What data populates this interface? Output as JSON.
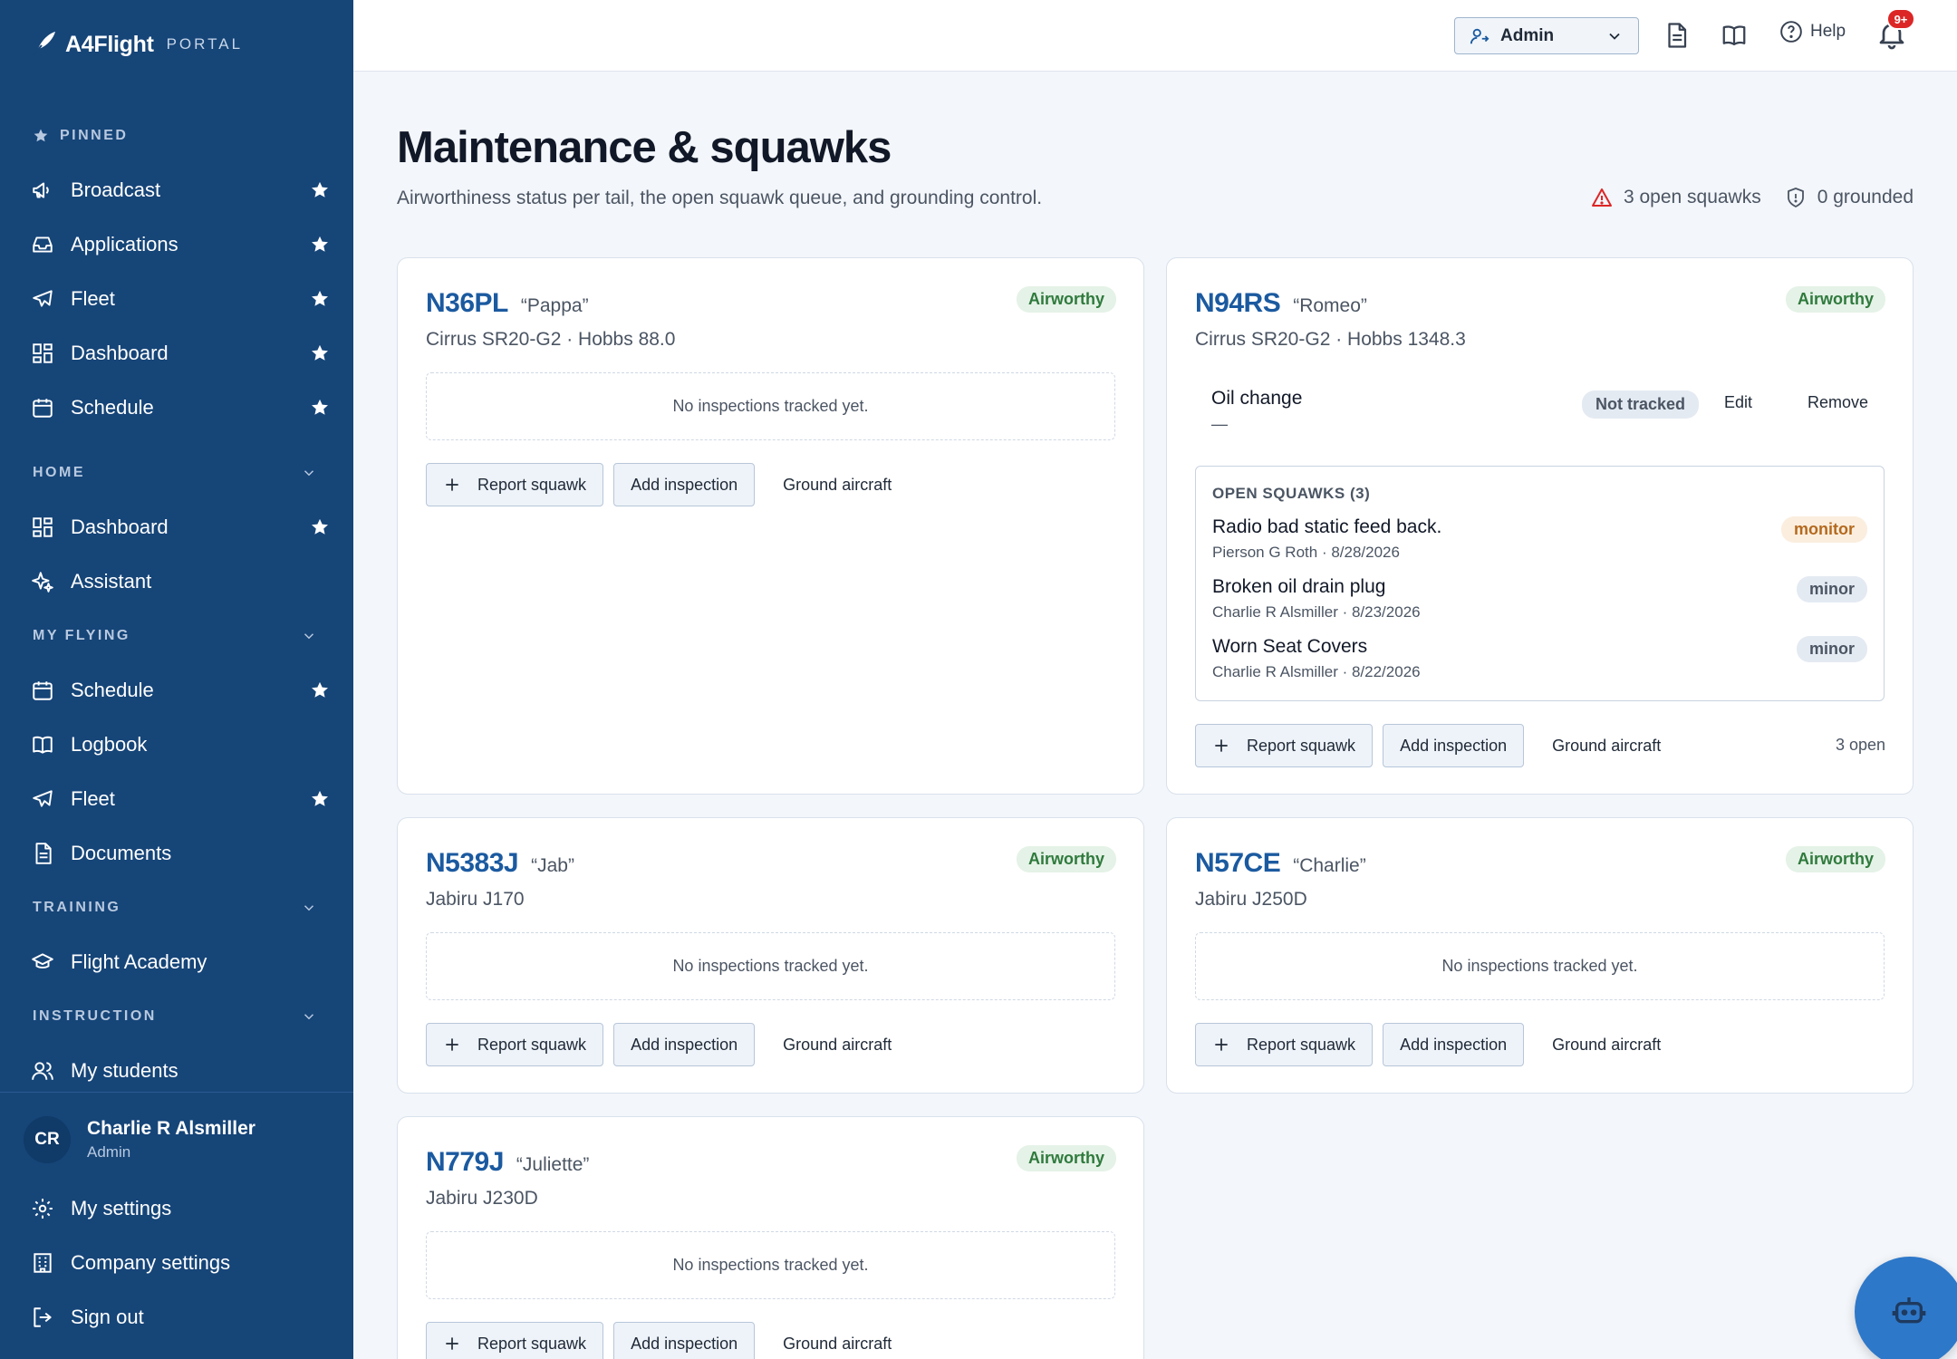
{
  "brand": {
    "name": "A4Flight",
    "sub": "PORTAL"
  },
  "sidebar": {
    "pinned_label": "PINNED",
    "pinned": [
      {
        "label": "Broadcast",
        "icon": "megaphone-icon"
      },
      {
        "label": "Applications",
        "icon": "inbox-icon"
      },
      {
        "label": "Fleet",
        "icon": "plane-icon"
      },
      {
        "label": "Dashboard",
        "icon": "dashboard-icon"
      },
      {
        "label": "Schedule",
        "icon": "calendar-icon"
      }
    ],
    "home_label": "HOME",
    "home": [
      {
        "label": "Dashboard",
        "icon": "dashboard-icon"
      },
      {
        "label": "Assistant",
        "icon": "sparkles-icon"
      }
    ],
    "my_flying_label": "MY FLYING",
    "my_flying": [
      {
        "label": "Schedule",
        "icon": "calendar-icon"
      },
      {
        "label": "Logbook",
        "icon": "book-icon"
      },
      {
        "label": "Fleet",
        "icon": "plane-icon"
      },
      {
        "label": "Documents",
        "icon": "document-icon"
      }
    ],
    "training_label": "TRAINING",
    "training": [
      {
        "label": "Flight Academy",
        "icon": "graduation-cap-icon"
      }
    ],
    "instruction_label": "INSTRUCTION",
    "instruction": [
      {
        "label": "My students",
        "icon": "users-icon"
      }
    ]
  },
  "user": {
    "initials": "CR",
    "name": "Charlie R Alsmiller",
    "role": "Admin",
    "links": [
      {
        "label": "My settings",
        "icon": "gear-icon"
      },
      {
        "label": "Company settings",
        "icon": "building-icon"
      },
      {
        "label": "Sign out",
        "icon": "sign-out-icon"
      }
    ]
  },
  "topbar": {
    "role": "Admin",
    "help": "Help",
    "notifications": "9+"
  },
  "page": {
    "title": "Maintenance & squawks",
    "subtitle": "Airworthiness status per tail, the open squawk queue, and grounding control.",
    "open_squawks": "3 open squawks",
    "grounded": "0 grounded"
  },
  "common": {
    "no_inspections": "No inspections tracked yet.",
    "report_squawk": "Report squawk",
    "add_inspection": "Add inspection",
    "ground_aircraft": "Ground aircraft"
  },
  "aircraft": [
    {
      "tail": "N36PL",
      "nick": "“Pappa”",
      "model": "Cirrus SR20-G2 · Hobbs 88.0",
      "status": "Airworthy"
    },
    {
      "tail": "N94RS",
      "nick": "“Romeo”",
      "model": "Cirrus SR20-G2 · Hobbs 1348.3",
      "status": "Airworthy",
      "inspection": {
        "name": "Oil change",
        "due": "—",
        "state": "Not tracked",
        "edit": "Edit",
        "remove": "Remove"
      },
      "squawks_header": "OPEN SQUAWKS (3)",
      "squawks": [
        {
          "title": "Radio bad static feed back.",
          "meta": "Pierson G Roth · 8/28/2026",
          "severity": "monitor"
        },
        {
          "title": "Broken oil drain plug",
          "meta": "Charlie R Alsmiller · 8/23/2026",
          "severity": "minor"
        },
        {
          "title": "Worn Seat Covers",
          "meta": "Charlie R Alsmiller · 8/22/2026",
          "severity": "minor"
        }
      ],
      "open_count": "3 open"
    },
    {
      "tail": "N5383J",
      "nick": "“Jab”",
      "model": "Jabiru J170",
      "status": "Airworthy"
    },
    {
      "tail": "N57CE",
      "nick": "“Charlie”",
      "model": "Jabiru J250D",
      "status": "Airworthy"
    },
    {
      "tail": "N779J",
      "nick": "“Juliette”",
      "model": "Jabiru J230D",
      "status": "Airworthy"
    }
  ],
  "colors": {
    "sidebar": "#164578",
    "accent": "#1b5aa0",
    "airworthy": "#2f7a3d",
    "alert": "#dc2626",
    "fab": "#2e78c9"
  }
}
